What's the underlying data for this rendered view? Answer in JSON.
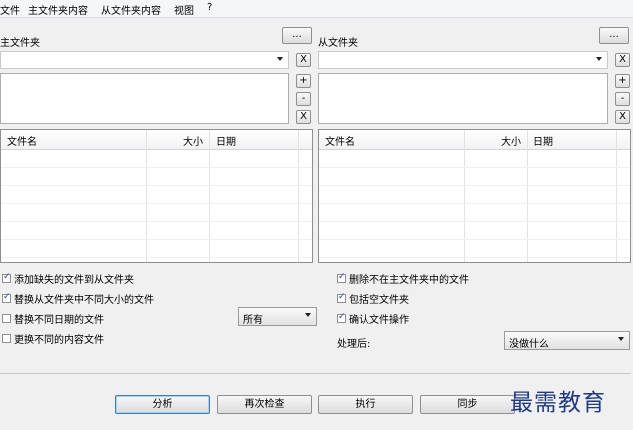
{
  "menu": {
    "file": "文件",
    "master": "主文件夹内容",
    "slave": "从文件夹内容",
    "view": "视图",
    "help": "?"
  },
  "left": {
    "title": "主文件夹",
    "browse": "...",
    "path_value": "",
    "clear": "X",
    "add": "+",
    "remove": "-",
    "remove_all": "X",
    "columns": {
      "name": "文件名",
      "size": "大小",
      "date": "日期"
    }
  },
  "right": {
    "title": "从文件夹",
    "browse": "...",
    "path_value": "",
    "clear": "X",
    "add": "+",
    "remove": "-",
    "remove_all": "X",
    "columns": {
      "name": "文件名",
      "size": "大小",
      "date": "日期"
    }
  },
  "options_left": [
    {
      "label": "添加缺失的文件到从文件夹",
      "checked": true
    },
    {
      "label": "替换从文件夹中不同大小的文件",
      "checked": true
    },
    {
      "label": "替换不同日期的文件",
      "checked": false
    },
    {
      "label": "更换不同的内容文件",
      "checked": false
    }
  ],
  "date_filter": {
    "value": "所有"
  },
  "options_right": [
    {
      "label": "删除不在主文件夹中的文件",
      "checked": true
    },
    {
      "label": "包括空文件夹",
      "checked": true
    },
    {
      "label": "确认文件操作",
      "checked": true
    }
  ],
  "after": {
    "label": "处理后:",
    "value": "没做什么"
  },
  "actions": {
    "analyze": "分析",
    "recheck": "再次检查",
    "execute": "执行",
    "sync": "同步"
  },
  "watermark": "最需教育"
}
